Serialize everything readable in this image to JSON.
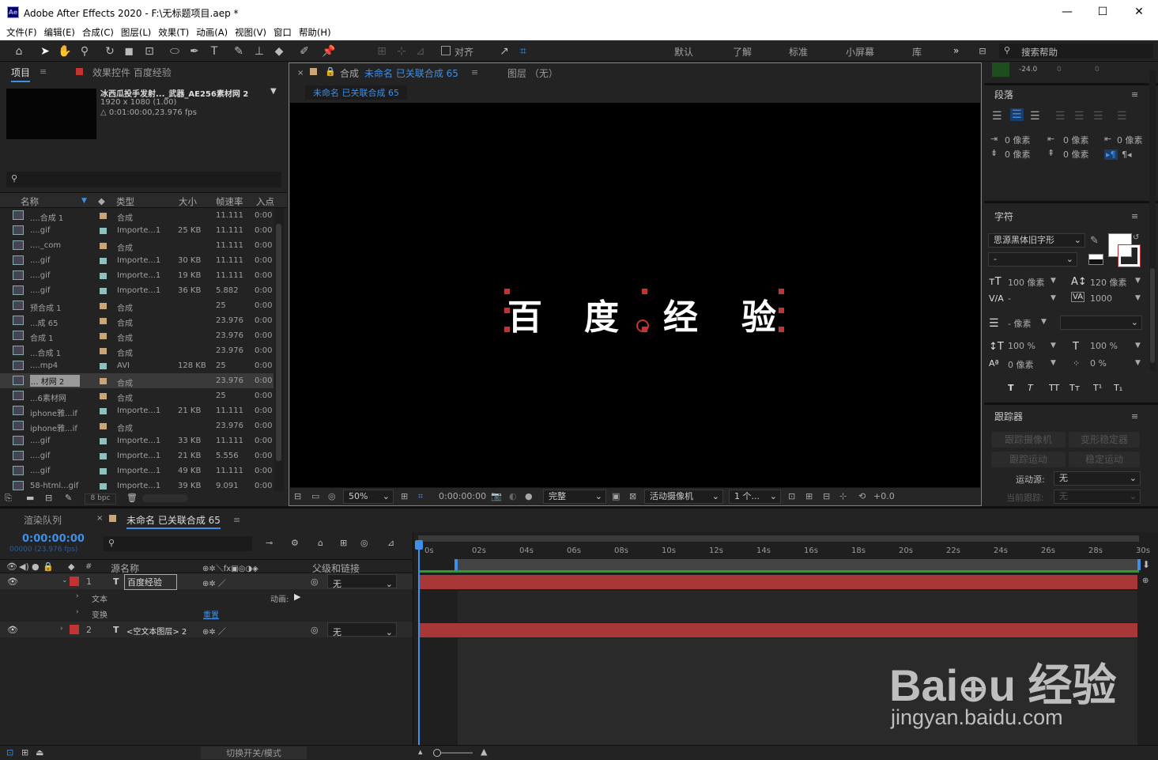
{
  "window": {
    "title": "Adobe After Effects 2020 - F:\\无标题项目.aep *",
    "logo": "Ae"
  },
  "menu": [
    "文件(F)",
    "编辑(E)",
    "合成(C)",
    "图层(L)",
    "效果(T)",
    "动画(A)",
    "视图(V)",
    "窗口",
    "帮助(H)"
  ],
  "toolbar": {
    "align_label": "对齐",
    "workspaces": [
      "默认",
      "了解",
      "标准",
      "小屏幕",
      "库"
    ],
    "search_placeholder": "搜索帮助"
  },
  "project": {
    "tab": "项目",
    "effects_tab": "效果控件 百度经验",
    "item_name": "冰西瓜投手发射..._武器_AE256素材网 2",
    "item_res": "1920 x 1080 (1.00)",
    "item_dur": "△ 0:01:00:00,23.976 fps",
    "columns": [
      "名称",
      "类型",
      "大小",
      "帧速率",
      "入点"
    ],
    "rows": [
      {
        "name": "....合成 1",
        "type": "合成",
        "size": "",
        "fps": "11.111",
        "in": "0:00",
        "kind": "comp"
      },
      {
        "name": "....gif",
        "type": "Importe...1",
        "size": "25 KB",
        "fps": "11.111",
        "in": "0:00",
        "kind": "file"
      },
      {
        "name": "...._com",
        "type": "合成",
        "size": "",
        "fps": "11.111",
        "in": "0:00",
        "kind": "comp"
      },
      {
        "name": "....gif",
        "type": "Importe...1",
        "size": "30 KB",
        "fps": "11.111",
        "in": "0:00",
        "kind": "file"
      },
      {
        "name": "....gif",
        "type": "Importe...1",
        "size": "19 KB",
        "fps": "11.111",
        "in": "0:00",
        "kind": "file"
      },
      {
        "name": "....gif",
        "type": "Importe...1",
        "size": "36 KB",
        "fps": "5.882",
        "in": "0:00",
        "kind": "file"
      },
      {
        "name": "预合成 1",
        "type": "合成",
        "size": "",
        "fps": "25",
        "in": "0:00",
        "kind": "comp"
      },
      {
        "name": "...成 65",
        "type": "合成",
        "size": "",
        "fps": "23.976",
        "in": "0:00",
        "kind": "comp"
      },
      {
        "name": "合成 1",
        "type": "合成",
        "size": "",
        "fps": "23.976",
        "in": "0:00",
        "kind": "comp"
      },
      {
        "name": "...合成 1",
        "type": "合成",
        "size": "",
        "fps": "23.976",
        "in": "0:00",
        "kind": "comp"
      },
      {
        "name": "....mp4",
        "type": "AVI",
        "size": "128 KB",
        "fps": "25",
        "in": "0:00",
        "kind": "file"
      },
      {
        "name": "... 材网 2",
        "type": "合成",
        "size": "",
        "fps": "23.976",
        "in": "0:00",
        "kind": "comp",
        "selected": true
      },
      {
        "name": "...6素材网",
        "type": "合成",
        "size": "",
        "fps": "25",
        "in": "0:00",
        "kind": "comp"
      },
      {
        "name": "iphone雅...if",
        "type": "Importe...1",
        "size": "21 KB",
        "fps": "11.111",
        "in": "0:00",
        "kind": "file"
      },
      {
        "name": "iphone雅...if",
        "type": "合成",
        "size": "",
        "fps": "23.976",
        "in": "0:00",
        "kind": "comp"
      },
      {
        "name": "....gif",
        "type": "Importe...1",
        "size": "33 KB",
        "fps": "11.111",
        "in": "0:00",
        "kind": "file"
      },
      {
        "name": "....gif",
        "type": "Importe...1",
        "size": "21 KB",
        "fps": "5.556",
        "in": "0:00",
        "kind": "file"
      },
      {
        "name": "....gif",
        "type": "Importe...1",
        "size": "49 KB",
        "fps": "11.111",
        "in": "0:00",
        "kind": "file"
      },
      {
        "name": "58-html...gif",
        "type": "Importe...1",
        "size": "39 KB",
        "fps": "9.091",
        "in": "0:00",
        "kind": "file"
      }
    ],
    "bpc": "8 bpc"
  },
  "comp": {
    "tab_prefix": "合成",
    "tab_name": "未命名 已关联合成 65",
    "layer_tab": "图层 （无）",
    "crumb": "未命名 已关联合成 65",
    "text_chars": [
      "百",
      "度",
      "经",
      "验"
    ],
    "zoom": "50%",
    "timecode": "0:00:00:00",
    "quality": "完整",
    "camera": "活动摄像机",
    "views": "1 个...",
    "exposure": "+0.0"
  },
  "paragraph": {
    "title": "段落",
    "indent_values": [
      "0 像素",
      "0 像素",
      "0 像素",
      "0 像素",
      "0 像素"
    ]
  },
  "character": {
    "title": "字符",
    "font": "思源黑体旧字形",
    "style": "-",
    "size": "100 像素",
    "leading": "120 像素",
    "kerning": "-",
    "tracking": "1000",
    "stroke": "- 像素",
    "vscale": "100 %",
    "hscale": "100 %",
    "baseline": "0 像素",
    "tsume": "0 %",
    "styles": [
      "T",
      "T",
      "TT",
      "Tт",
      "T¹",
      "T₁"
    ],
    "top_value": "-24.0",
    "top_zeros": [
      "0",
      "0"
    ]
  },
  "tracker": {
    "title": "跟踪器",
    "btn_camera": "跟踪摄像机",
    "btn_warp": "变形稳定器",
    "btn_motion": "跟踪运动",
    "btn_stab": "稳定运动",
    "source_label": "运动源:",
    "source_value": "无",
    "current_label": "当前跟踪:",
    "current_value": "无"
  },
  "timeline": {
    "render_tab": "渲染队列",
    "comp_tab": "未命名 已关联合成 65",
    "timecode": "0:00:00:00",
    "frames": "00000 (23.976 fps)",
    "col_source": "源名称",
    "col_parent": "父级和链接",
    "col_hash": "#",
    "layers": [
      {
        "num": "1",
        "name": "百度经验",
        "parent": "无",
        "color": "#c03434"
      },
      {
        "num": "2",
        "name": "<空文本图层> 2",
        "parent": "无",
        "color": "#c03434"
      }
    ],
    "sub": {
      "text": "文本",
      "transform": "变换",
      "animate": "动画:",
      "reset": "重置"
    },
    "ruler": [
      "0s",
      "02s",
      "04s",
      "06s",
      "08s",
      "10s",
      "12s",
      "14s",
      "16s",
      "18s",
      "20s",
      "22s",
      "24s",
      "26s",
      "28s",
      "30s"
    ],
    "toggle": "切换开关/模式"
  },
  "watermark": {
    "url": "jingyan.baidu.com"
  }
}
